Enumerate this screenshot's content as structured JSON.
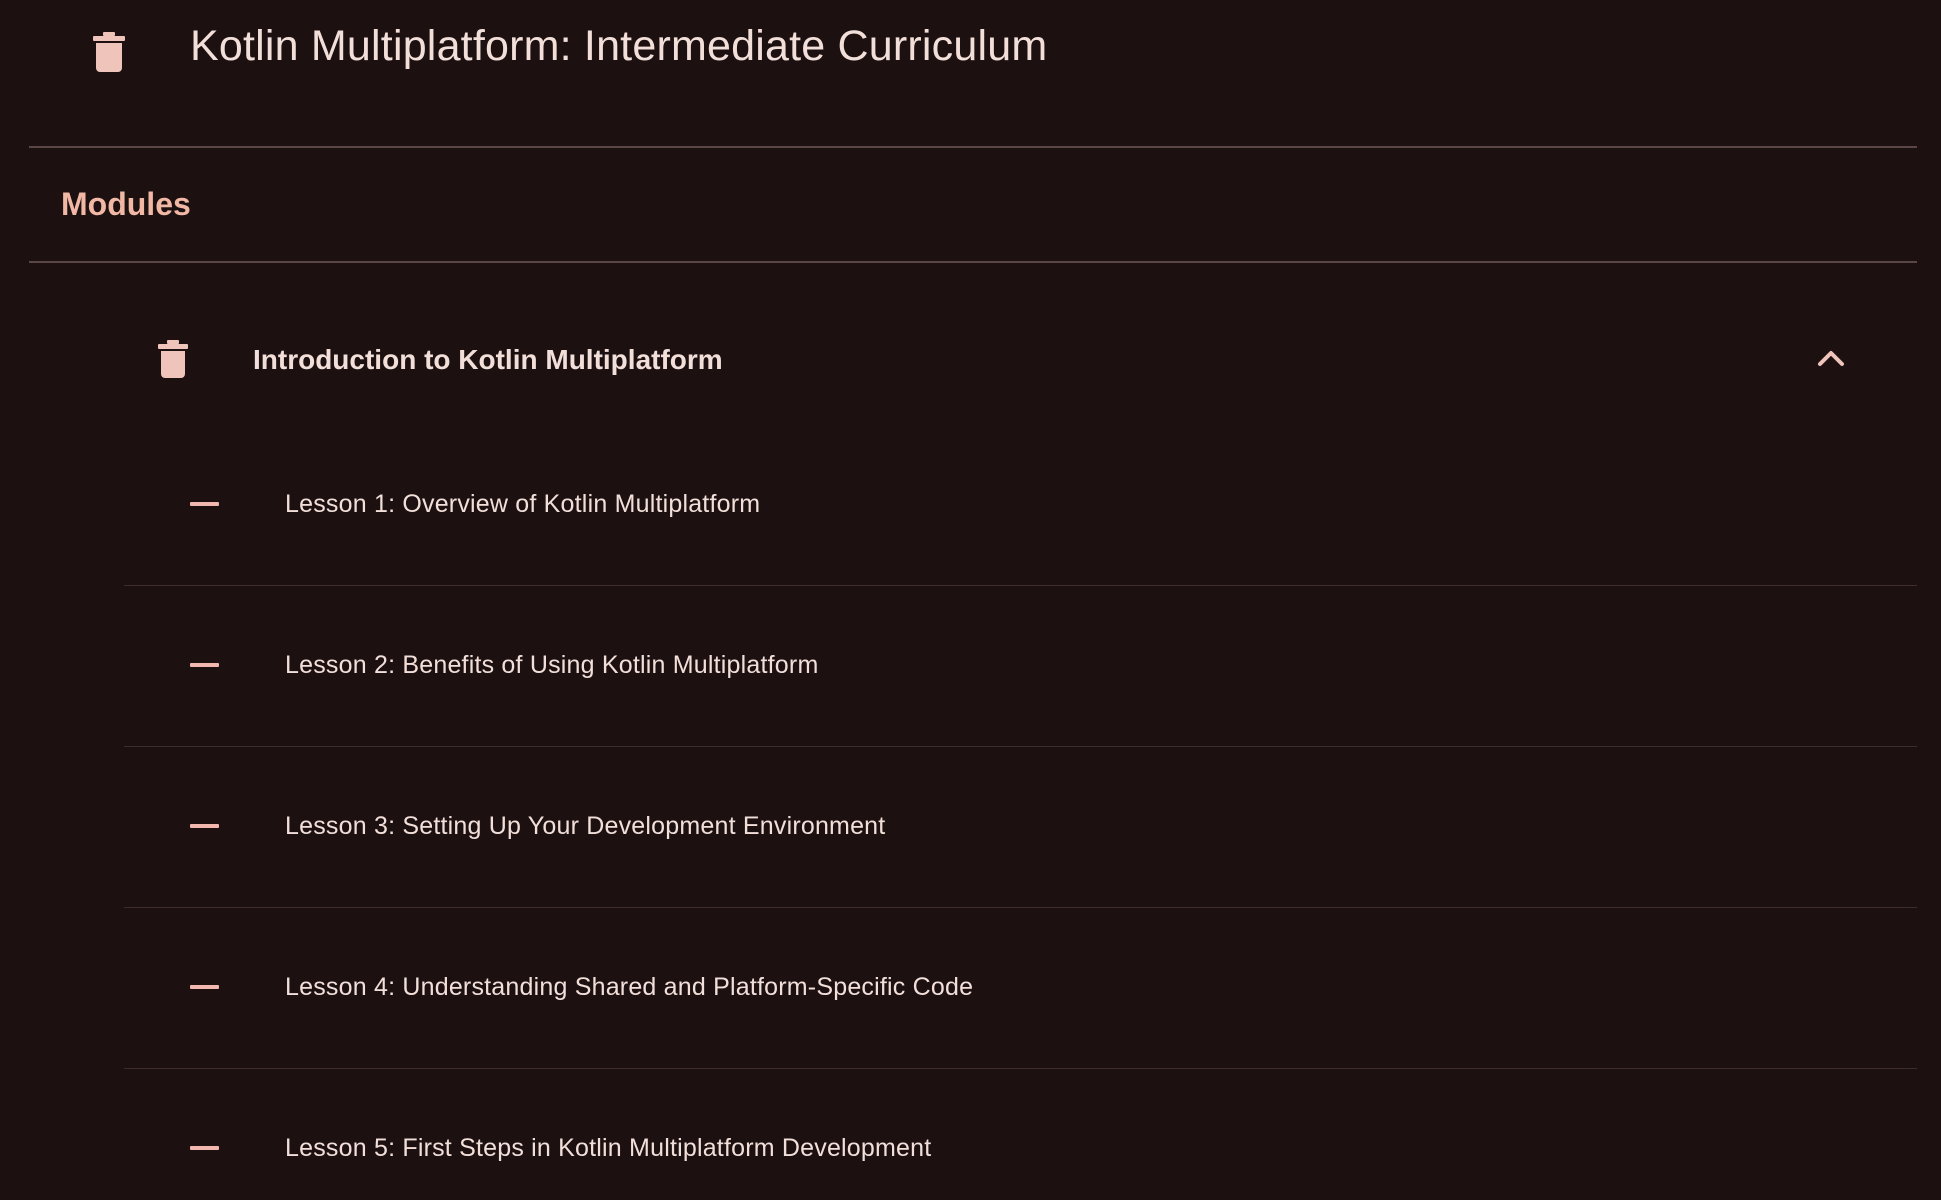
{
  "header": {
    "title": "Kotlin Multiplatform: Intermediate Curriculum",
    "icon": "trash-icon"
  },
  "section": {
    "label": "Modules"
  },
  "module": {
    "title": "Introduction to Kotlin Multiplatform",
    "icon": "trash-icon",
    "expanded_icon": "chevron-up-icon",
    "lessons": [
      {
        "label": "Lesson 1: Overview of Kotlin Multiplatform",
        "icon": "minus-icon"
      },
      {
        "label": "Lesson 2: Benefits of Using Kotlin Multiplatform",
        "icon": "minus-icon"
      },
      {
        "label": "Lesson 3: Setting Up Your Development Environment",
        "icon": "minus-icon"
      },
      {
        "label": "Lesson 4: Understanding Shared and Platform-Specific Code",
        "icon": "minus-icon"
      },
      {
        "label": "Lesson 5: First Steps in Kotlin Multiplatform Development",
        "icon": "minus-icon"
      }
    ]
  },
  "colors": {
    "background": "#1c1110",
    "text": "#f2dfda",
    "accent": "#f2b8a6",
    "divider": "#5a4644"
  }
}
